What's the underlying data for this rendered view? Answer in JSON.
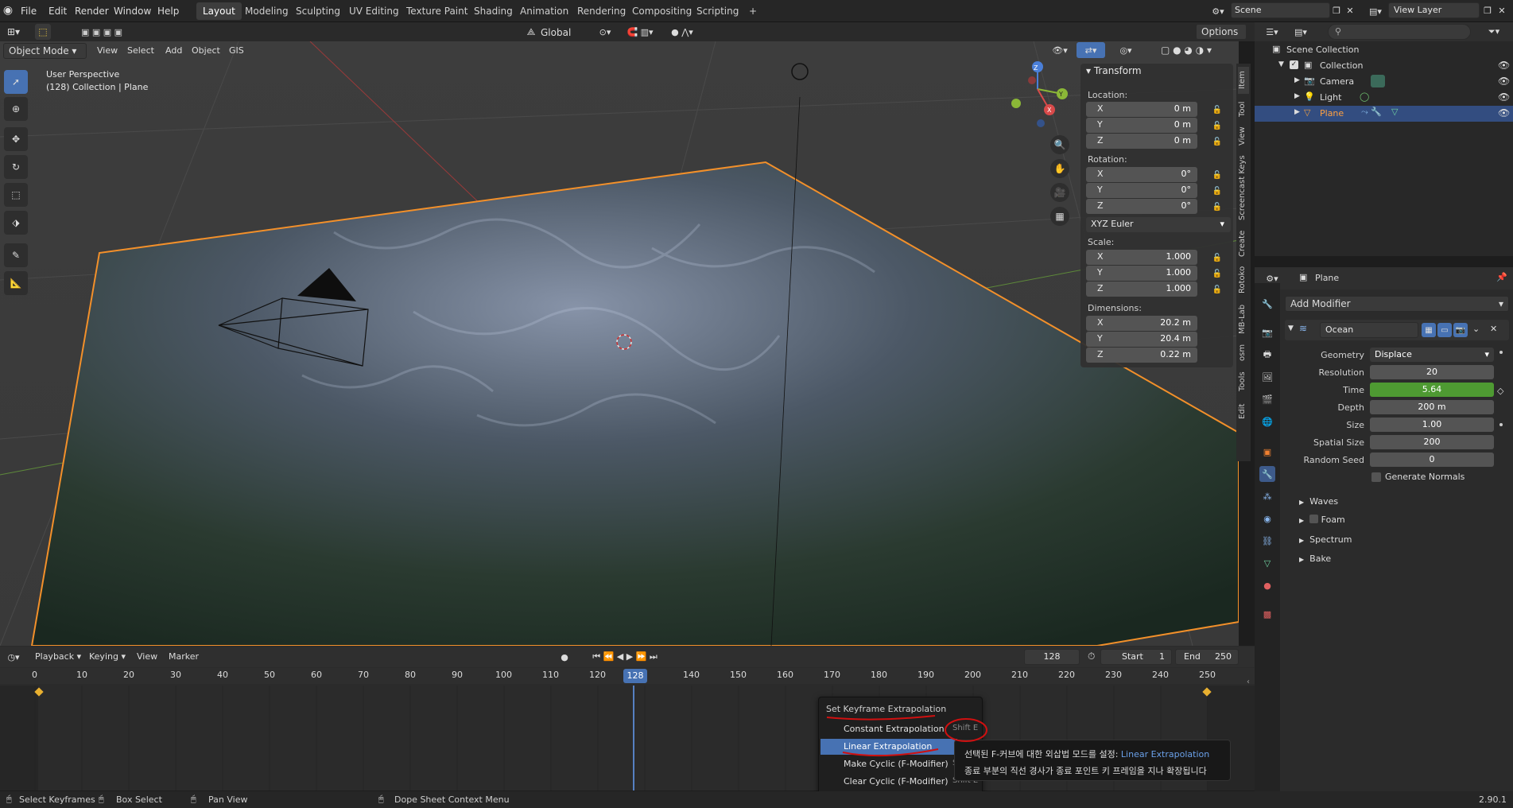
{
  "topbar": {
    "menus": [
      "File",
      "Edit",
      "Render",
      "Window",
      "Help"
    ],
    "workspaces": [
      "Layout",
      "Modeling",
      "Sculpting",
      "UV Editing",
      "Texture Paint",
      "Shading",
      "Animation",
      "Rendering",
      "Compositing",
      "Scripting"
    ],
    "active_workspace": "Layout",
    "add_tab": "+",
    "scene": "Scene",
    "view_layer": "View Layer"
  },
  "viewport_header": {
    "mode": "Object Mode",
    "menus": [
      "View",
      "Select",
      "Add",
      "Object",
      "GIS"
    ],
    "orientation": "Global",
    "options": "Options"
  },
  "viewport": {
    "perspective": "User Perspective",
    "collection_info": "(128) Collection | Plane"
  },
  "npanel": {
    "section": "Transform",
    "location_label": "Location:",
    "location": [
      {
        "axis": "X",
        "value": "0 m"
      },
      {
        "axis": "Y",
        "value": "0 m"
      },
      {
        "axis": "Z",
        "value": "0 m"
      }
    ],
    "rotation_label": "Rotation:",
    "rotation": [
      {
        "axis": "X",
        "value": "0°"
      },
      {
        "axis": "Y",
        "value": "0°"
      },
      {
        "axis": "Z",
        "value": "0°"
      }
    ],
    "rotation_mode": "XYZ Euler",
    "scale_label": "Scale:",
    "scale": [
      {
        "axis": "X",
        "value": "1.000"
      },
      {
        "axis": "Y",
        "value": "1.000"
      },
      {
        "axis": "Z",
        "value": "1.000"
      }
    ],
    "dimensions_label": "Dimensions:",
    "dimensions": [
      {
        "axis": "X",
        "value": "20.2 m"
      },
      {
        "axis": "Y",
        "value": "20.4 m"
      },
      {
        "axis": "Z",
        "value": "0.22 m"
      }
    ],
    "tabs": [
      "Item",
      "Tool",
      "View",
      "Screencast Keys",
      "Create",
      "Rotoko",
      "MB-Lab",
      "osm",
      "Tools",
      "Edit"
    ]
  },
  "outliner": {
    "search_placeholder": "",
    "root": "Scene Collection",
    "items": [
      {
        "name": "Collection"
      },
      {
        "name": "Camera"
      },
      {
        "name": "Light"
      },
      {
        "name": "Plane"
      }
    ]
  },
  "properties": {
    "object": "Plane",
    "add_modifier": "Add Modifier",
    "modifier_name": "Ocean",
    "rows": [
      {
        "label": "Geometry",
        "value": "Displace"
      },
      {
        "label": "Resolution",
        "value": "20"
      },
      {
        "label": "Time",
        "value": "5.64"
      },
      {
        "label": "Depth",
        "value": "200 m"
      },
      {
        "label": "Size",
        "value": "1.00"
      },
      {
        "label": "Spatial Size",
        "value": "200"
      },
      {
        "label": "Random Seed",
        "value": "0"
      }
    ],
    "generate_normals": "Generate Normals",
    "panels": [
      "Waves",
      "Foam",
      "Spectrum",
      "Bake"
    ]
  },
  "timeline": {
    "menus": [
      "Playback",
      "Keying",
      "View",
      "Marker"
    ],
    "current_frame": "128",
    "start_label": "Start",
    "start": "1",
    "end_label": "End",
    "end": "250",
    "ticks": [
      "0",
      "10",
      "20",
      "30",
      "40",
      "50",
      "60",
      "70",
      "80",
      "90",
      "100",
      "110",
      "120",
      "",
      "140",
      "150",
      "160",
      "170",
      "180",
      "190",
      "200",
      "210",
      "220",
      "230",
      "240",
      "250"
    ],
    "playhead_label": "128"
  },
  "context_menu": {
    "title": "Set Keyframe Extrapolation",
    "items": [
      {
        "label": "Constant Extrapolation",
        "shortcut": "Shift E"
      },
      {
        "label": "Linear Extrapolation",
        "shortcut": ""
      },
      {
        "label": "Make Cyclic (F-Modifier)",
        "shortcut": "S"
      },
      {
        "label": "Clear Cyclic (F-Modifier)",
        "shortcut": "Shift E"
      }
    ]
  },
  "tooltip": {
    "line1_prefix": "선택된 F-커브에 대한 외삽법 모드를 설정: ",
    "line1_value": "Linear Extrapolation",
    "line2": "종료 부분의 직선 경사가 종료 포인트 키 프레임을 지나 확장됩니다"
  },
  "statusbar": {
    "select": "Select Keyframes",
    "box": "Box Select",
    "pan": "Pan View",
    "context": "Dope Sheet Context Menu",
    "version": "2.90.1"
  }
}
